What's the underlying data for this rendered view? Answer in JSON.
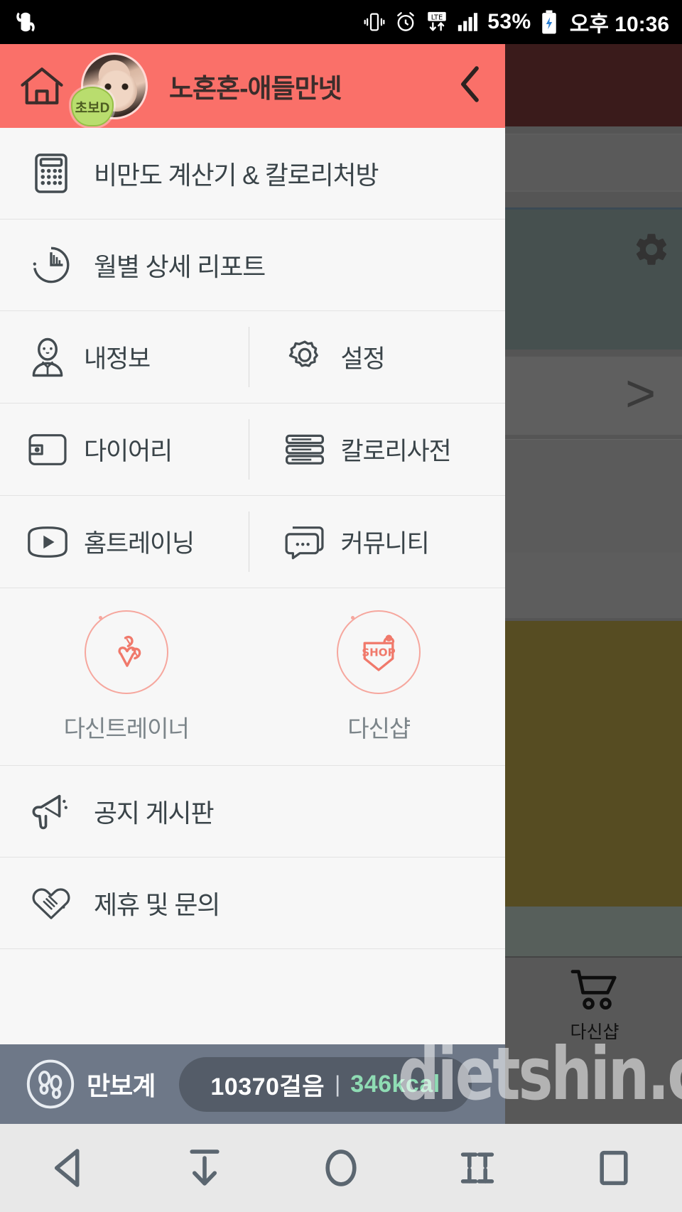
{
  "status_bar": {
    "carrier_icon": "u-plus-logo-icon",
    "icons": [
      "vibrate-icon",
      "alarm-icon",
      "lte-data-icon",
      "signal-bars-icon"
    ],
    "battery_percent": "53%",
    "battery_icon": "battery-charging-icon",
    "time": "오후 10:36"
  },
  "drawer": {
    "header": {
      "home_icon": "home-icon",
      "avatar": "user-avatar",
      "badge_label": "초보D",
      "username": "노혼혼-애들만넷",
      "back_icon": "chevron-left-icon",
      "accent_color": "#fa7069"
    },
    "rows": [
      {
        "icon": "calculator-icon",
        "label": "비만도 계산기 & 칼로리처방"
      },
      {
        "icon": "pie-chart-icon",
        "label": "월별 상세 리포트"
      }
    ],
    "pair_rows": [
      {
        "left": {
          "icon": "person-icon",
          "label": "내정보"
        },
        "right": {
          "icon": "gear-icon",
          "label": "설정"
        }
      },
      {
        "left": {
          "icon": "wallet-icon",
          "label": "다이어리"
        },
        "right": {
          "icon": "book-stack-icon",
          "label": "칼로리사전"
        }
      },
      {
        "left": {
          "icon": "play-video-icon",
          "label": "홈트레이닝"
        },
        "right": {
          "icon": "chat-bubble-icon",
          "label": "커뮤니티"
        }
      }
    ],
    "promos": [
      {
        "icon": "dumbbell-trainer-icon",
        "label": "다신트레이너",
        "color": "#f28a7e"
      },
      {
        "icon": "shop-tag-icon",
        "badge_text": "SHOP",
        "label": "다신샵",
        "color": "#f28a7e"
      }
    ],
    "bottom_rows": [
      {
        "icon": "megaphone-icon",
        "label": "공지 게시판"
      },
      {
        "icon": "handshake-heart-icon",
        "label": "제휴 및 문의"
      }
    ],
    "pedometer": {
      "icon": "footprints-icon",
      "label": "만보계",
      "steps": "10370걸음",
      "separator": "|",
      "kcal": "346kcal",
      "kcal_color": "#8fdcb4",
      "bar_color": "#6e7888"
    }
  },
  "background": {
    "gear_icon": "gear-icon",
    "chevron_icon": "chevron-right-icon",
    "cart_icon": "shopping-cart-icon",
    "cart_label": "다신샵"
  },
  "watermark": {
    "text": "dietshin.com"
  },
  "nav_bar": {
    "buttons": [
      {
        "icon": "back-triangle-icon",
        "name": "back-button"
      },
      {
        "icon": "download-arrow-icon",
        "name": "download-button"
      },
      {
        "icon": "home-circle-icon",
        "name": "home-button"
      },
      {
        "icon": "collapse-icon",
        "name": "collapse-button"
      },
      {
        "icon": "recents-square-icon",
        "name": "recents-button"
      }
    ]
  }
}
